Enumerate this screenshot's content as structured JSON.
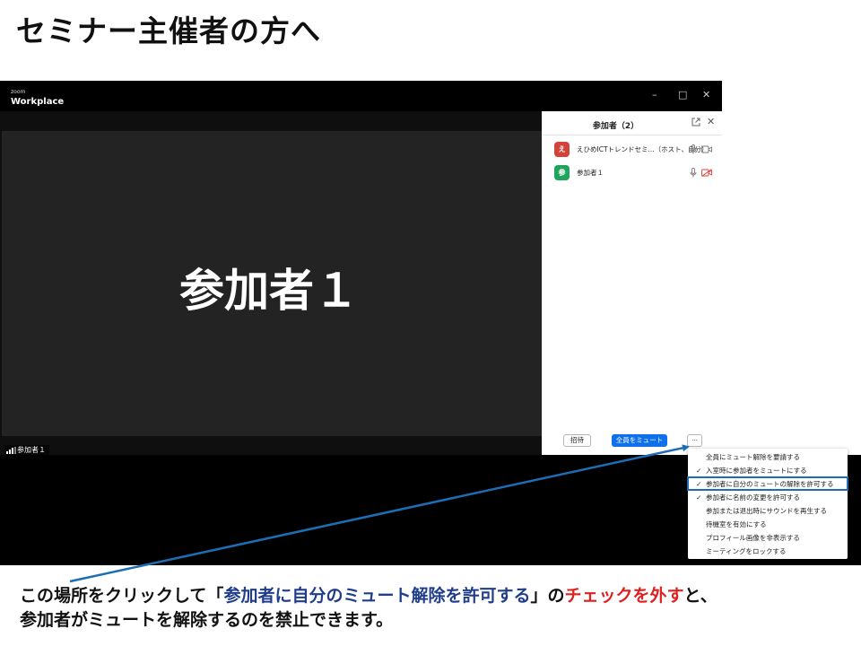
{
  "slide": {
    "title": "セミナー主催者の方へ"
  },
  "window": {
    "brand_small": "zoom",
    "brand_main": "Workplace",
    "controls": {
      "minimize": "–",
      "maximize": "□",
      "close": "✕"
    }
  },
  "video": {
    "participant_name": "参加者１",
    "tile_label": "参加者１"
  },
  "panel": {
    "title": "参加者（2）",
    "close": "✕",
    "participants": [
      {
        "avatar": "え",
        "avatar_color": "#d2423a",
        "name": "えひめICTトレンドセミ...（ホスト、自分）",
        "mic": "mic-on",
        "video": "video-on"
      },
      {
        "avatar": "参",
        "avatar_color": "#1fa45b",
        "name": "参加者１",
        "mic": "mic-on",
        "video": "video-off"
      }
    ],
    "buttons": {
      "invite": "招待",
      "mute_all": "全員をミュート",
      "more": "..."
    }
  },
  "menu": {
    "items": [
      {
        "checked": false,
        "label": "全員にミュート解除を要請する"
      },
      {
        "checked": true,
        "label": "入室時に参加者をミュートにする"
      },
      {
        "checked": true,
        "label": "参加者に自分のミュートの解除を許可する"
      },
      {
        "checked": true,
        "label": "参加者に名前の変更を許可する"
      },
      {
        "checked": false,
        "label": "参加または退出時にサウンドを再生する"
      },
      {
        "checked": false,
        "label": "待機室を有効にする"
      },
      {
        "checked": false,
        "label": "プロフィール画像を非表示する"
      },
      {
        "checked": false,
        "label": "ミーティングをロックする"
      }
    ],
    "check_glyph": "✓"
  },
  "caption": {
    "part1": "この場所をクリックして「",
    "part2": "参加者に自分のミュート解除を許可する",
    "part3": "」の",
    "part4": "チェックを外す",
    "part5": "と、",
    "line2": "参加者がミュートを解除するのを禁止できます。"
  },
  "colors": {
    "accent_blue": "#0e71eb",
    "highlight_border": "#1d6db5",
    "caption_blue": "#1f3d8a",
    "caption_red": "#e02020"
  }
}
